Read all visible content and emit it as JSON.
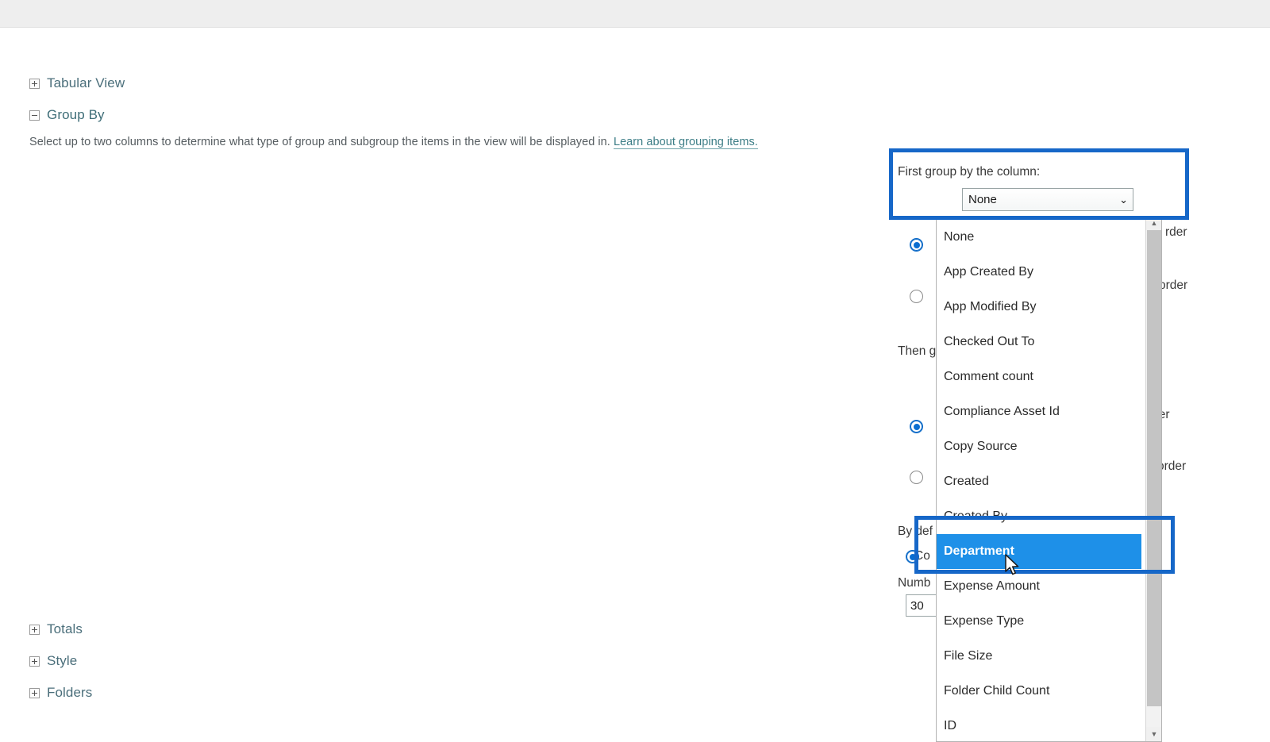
{
  "sections": [
    {
      "key": "tabular",
      "label": "Tabular View",
      "expanded": false,
      "icon": "plus-box-icon"
    },
    {
      "key": "groupby",
      "label": "Group By",
      "expanded": true,
      "icon": "minus-box-icon"
    },
    {
      "key": "totals",
      "label": "Totals",
      "expanded": false,
      "icon": "plus-box-icon"
    },
    {
      "key": "style",
      "label": "Style",
      "expanded": false,
      "icon": "plus-box-icon"
    },
    {
      "key": "folders",
      "label": "Folders",
      "expanded": false,
      "icon": "plus-box-icon"
    }
  ],
  "group_by": {
    "description": "Select up to two columns to determine what type of group and subgroup the items in the view will be displayed in.",
    "link_text": "Learn about grouping items.",
    "first_group_label": "First group by the column:",
    "first_group_value": "None",
    "then_group_label": "Then g",
    "by_default_label": "By def",
    "by_default_option": "Co",
    "number_of_groups_label": "Numb",
    "number_of_groups_value": "30",
    "first_sort_asc_label": "rder",
    "first_sort_desc_label": "order",
    "second_sort_asc_label": "rder",
    "second_sort_desc_label": "order",
    "chevron": "chevron-down-icon"
  },
  "dropdown": {
    "selected": "Department",
    "scroll_up_glyph": "▲",
    "scroll_down_glyph": "▼",
    "options": [
      "None",
      "App Created By",
      "App Modified By",
      "Checked Out To",
      "Comment count",
      "Compliance Asset Id",
      "Copy Source",
      "Created",
      "Created By",
      "Department",
      "Expense Amount",
      "Expense Type",
      "File Size",
      "Folder Child Count",
      "ID"
    ]
  },
  "colors": {
    "highlight_border": "#1667c8",
    "selection_blue": "#1e90e8",
    "link_teal": "#3c7d86",
    "section_title": "#4a6e7a",
    "radio_blue": "#0a6ed1",
    "top_band": "#eeeeee"
  }
}
